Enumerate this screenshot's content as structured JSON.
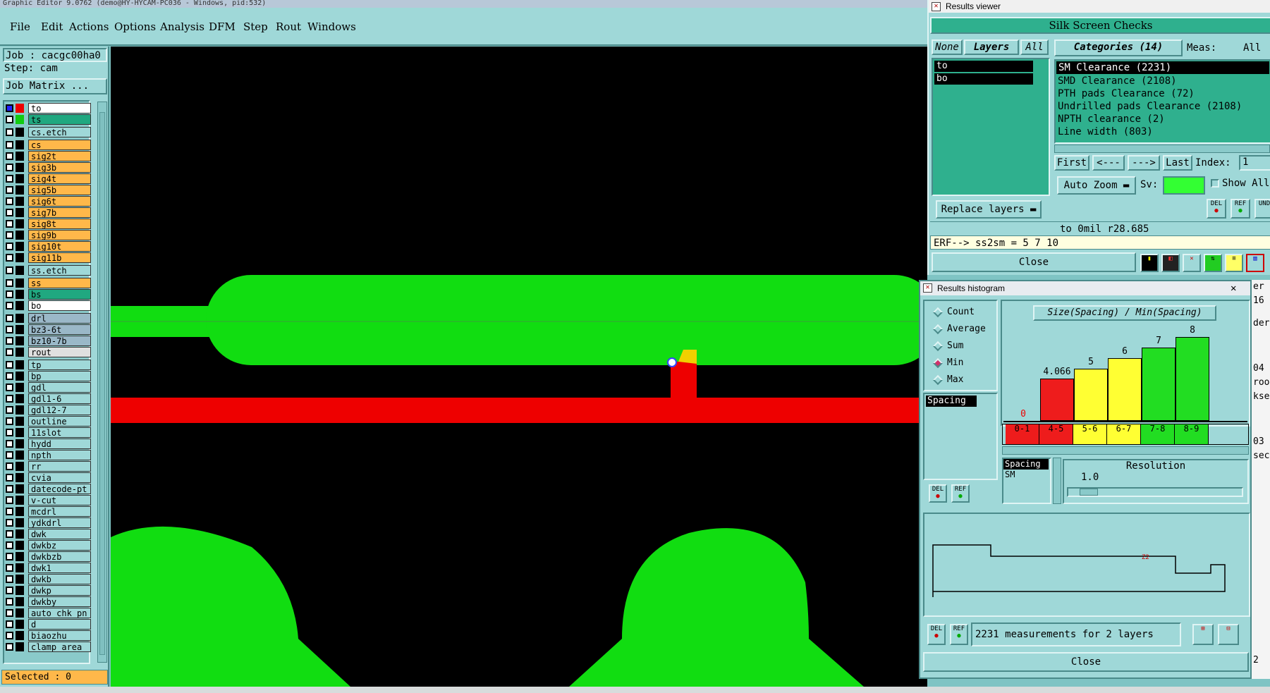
{
  "window_title": "Graphic Editor 9.0762 (demo@HY-HYCAM-PC036 - Windows, pid:532)",
  "menu": [
    "File",
    "Edit",
    "Actions",
    "Options",
    "Analysis",
    "DFM",
    "Step",
    "Rout",
    "Windows"
  ],
  "job": {
    "job_label": "Job : cacgc00ha0",
    "step_label": "Step: cam",
    "matrix_button": "Job Matrix ..."
  },
  "layers": [
    {
      "name": "to",
      "color": "#ffffff"
    },
    {
      "name": "ts",
      "color": "#20a880"
    },
    {
      "name": "cs.etch",
      "color": "#9fd8d8"
    },
    {
      "name": "cs",
      "color": "#ffb84a"
    },
    {
      "name": "sig2t",
      "color": "#ffb84a"
    },
    {
      "name": "sig3b",
      "color": "#ffb84a"
    },
    {
      "name": "sig4t",
      "color": "#ffb84a"
    },
    {
      "name": "sig5b",
      "color": "#ffb84a"
    },
    {
      "name": "sig6t",
      "color": "#ffb84a"
    },
    {
      "name": "sig7b",
      "color": "#ffb84a"
    },
    {
      "name": "sig8t",
      "color": "#ffb84a"
    },
    {
      "name": "sig9b",
      "color": "#ffb84a"
    },
    {
      "name": "sig10t",
      "color": "#ffb84a"
    },
    {
      "name": "sig11b",
      "color": "#ffb84a"
    },
    {
      "name": "ss.etch",
      "color": "#9fd8d8"
    },
    {
      "name": "ss",
      "color": "#ffb84a"
    },
    {
      "name": "bs",
      "color": "#20a880"
    },
    {
      "name": "bo",
      "color": "#ffffff"
    },
    {
      "name": "drl",
      "color": "#9ab8c8"
    },
    {
      "name": "bz3-6t",
      "color": "#9ab8c8"
    },
    {
      "name": "bz10-7b",
      "color": "#9ab8c8"
    },
    {
      "name": "rout",
      "color": "#e0e0e0"
    },
    {
      "name": "tp",
      "color": "#9fd8d8"
    },
    {
      "name": "bp",
      "color": "#9fd8d8"
    },
    {
      "name": "gdl",
      "color": "#9fd8d8"
    },
    {
      "name": "gdl1-6",
      "color": "#9fd8d8"
    },
    {
      "name": "gdl12-7",
      "color": "#9fd8d8"
    },
    {
      "name": "outline",
      "color": "#9fd8d8"
    },
    {
      "name": "11slot",
      "color": "#9fd8d8"
    },
    {
      "name": "hydd",
      "color": "#9fd8d8"
    },
    {
      "name": "npth",
      "color": "#9fd8d8"
    },
    {
      "name": "rr",
      "color": "#9fd8d8"
    },
    {
      "name": "cvia",
      "color": "#9fd8d8"
    },
    {
      "name": "datecode-pt",
      "color": "#9fd8d8"
    },
    {
      "name": "v-cut",
      "color": "#9fd8d8"
    },
    {
      "name": "mcdrl",
      "color": "#9fd8d8"
    },
    {
      "name": "ydkdrl",
      "color": "#9fd8d8"
    },
    {
      "name": "dwk",
      "color": "#9fd8d8"
    },
    {
      "name": "dwkbz",
      "color": "#9fd8d8"
    },
    {
      "name": "dwkbzb",
      "color": "#9fd8d8"
    },
    {
      "name": "dwk1",
      "color": "#9fd8d8"
    },
    {
      "name": "dwkb",
      "color": "#9fd8d8"
    },
    {
      "name": "dwkp",
      "color": "#9fd8d8"
    },
    {
      "name": "dwkby",
      "color": "#9fd8d8"
    },
    {
      "name": "auto_chk_pn",
      "color": "#9fd8d8"
    },
    {
      "name": "d",
      "color": "#9fd8d8"
    },
    {
      "name": "biaozhu",
      "color": "#9fd8d8"
    },
    {
      "name": "clamp_area",
      "color": "#9fd8d8"
    }
  ],
  "selected_label": "Selected : 0",
  "results_viewer": {
    "title": "Results viewer",
    "banner": "Silk Screen Checks",
    "none_btn": "None",
    "layers_btn": "Layers",
    "all_btn": "All",
    "layer_list": [
      "to",
      "bo"
    ],
    "categories_label": "Categories (14)",
    "meas_label": "Meas:",
    "meas_value": "All",
    "categories": [
      "SM Clearance (2231)",
      "SMD Clearance (2108)",
      "PTH pads Clearance (72)",
      "Undrilled pads Clearance (2108)",
      "NPTH clearance (2)",
      "Line width (803)"
    ],
    "first_btn": "First",
    "prev_btn": "<---",
    "next_btn": "--->",
    "last_btn": "Last",
    "index_label": "Index:",
    "index_value": "1",
    "autozoom_btn": "Auto Zoom",
    "sv_label": "Sv:",
    "show_all": "Show All",
    "replace_btn": "Replace layers",
    "info_line": "to 0mil  r28.685",
    "erf_line": "ERF--> ss2sm = 5 7 10",
    "close_btn": "Close",
    "del_label": "DEL",
    "ref_label": "REF",
    "und_label": "UND"
  },
  "histogram": {
    "title": "Results histogram",
    "modes": [
      "Count",
      "Average",
      "Sum",
      "Min",
      "Max"
    ],
    "selected_mode": "Min",
    "list_item": "Spacing",
    "chart_title": "Size(Spacing) / Min(Spacing)",
    "bins": [
      "0-1",
      "4-5",
      "5-6",
      "6-7",
      "7-8",
      "8-9"
    ],
    "bin_colors": [
      "#ee1c1c",
      "#ee1c1c",
      "#ffff33",
      "#ffff33",
      "#22dd22",
      "#22dd22"
    ],
    "values": [
      0,
      4.066,
      5,
      6,
      7,
      8
    ],
    "value_labels": [
      "0",
      "4.066",
      "5",
      "6",
      "7",
      "8"
    ],
    "ymax": 8.5,
    "sel_list": [
      "Spacing",
      "SM"
    ],
    "resolution_label": "Resolution",
    "resolution_value": "1.0",
    "graph_marker": "Z2",
    "measurements": "2231 measurements for 2 layers",
    "close_btn": "Close",
    "del_label": "DEL",
    "ref_label": "REF"
  },
  "side_fragments": [
    "er",
    "16",
    "der",
    "04",
    "roo",
    "kse",
    "03",
    "sec",
    "2"
  ],
  "colors": {
    "bg": "#9fd8d8",
    "green": "#11dd11",
    "red": "#ee0000",
    "yellow": "#f0d000"
  }
}
